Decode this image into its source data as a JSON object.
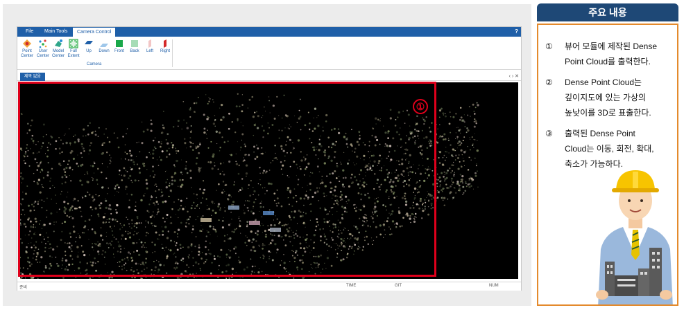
{
  "app": {
    "ribbon_tabs": [
      {
        "label": "File"
      },
      {
        "label": "Main Tools"
      },
      {
        "label": "Camera Control"
      }
    ],
    "help_label": "?",
    "ribbon_buttons": [
      {
        "label": "Point Center",
        "icon": "point-center-icon"
      },
      {
        "label": "User Center",
        "icon": "user-center-icon"
      },
      {
        "label": "Model Center",
        "icon": "model-center-icon"
      },
      {
        "label": "Full Extent",
        "icon": "full-extent-icon"
      },
      {
        "label": "Up",
        "icon": "view-up-icon"
      },
      {
        "label": "Down",
        "icon": "view-down-icon"
      },
      {
        "label": "Front",
        "icon": "view-front-icon"
      },
      {
        "label": "Back",
        "icon": "view-back-icon"
      },
      {
        "label": "Left",
        "icon": "view-left-icon"
      },
      {
        "label": "Right",
        "icon": "view-right-icon"
      }
    ],
    "group_label": "Camera",
    "doc_tab": "제목 없음",
    "doc_controls": "‹ › ✕",
    "status": {
      "left": "준비",
      "time": "TIME",
      "git": "GIT",
      "num": "NUM"
    },
    "marker": "①",
    "colors": {
      "ribbon": "#1f5fa8",
      "highlight": "#e0001b"
    }
  },
  "panel": {
    "title": "주요 내용",
    "points": [
      {
        "num": "①",
        "line1": "뷰어 모듈에 제작된 Dense",
        "line2": "Point Cloud를 출력한다.",
        "line3": ""
      },
      {
        "num": "②",
        "line1": "Dense Point Cloud는",
        "line2": "깊이지도에 있는 가상의",
        "line3": "높낮이를 3D로 표출한다."
      },
      {
        "num": "③",
        "line1": "출력된 Dense Point",
        "line2": "Cloud는 이동, 회전, 확대,",
        "line3": "축소가 가능하다."
      }
    ],
    "colors": {
      "header": "#1e4876",
      "border": "#e48a2c"
    }
  }
}
